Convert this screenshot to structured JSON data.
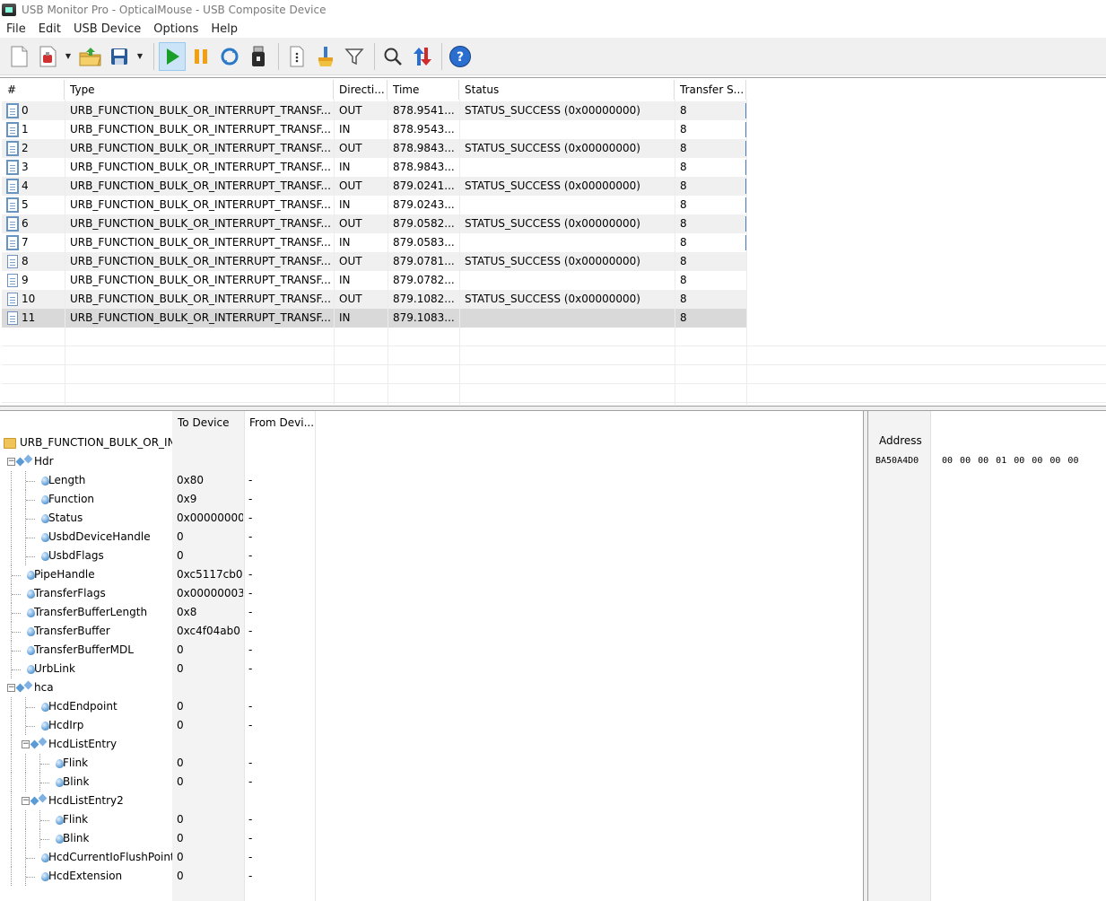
{
  "window": {
    "title": "USB Monitor Pro - OpticalMouse - USB Composite Device"
  },
  "menu": [
    "File",
    "Edit",
    "USB Device",
    "Options",
    "Help"
  ],
  "toolbar": {
    "buttons": [
      "new-icon",
      "open-session-icon",
      "open-folder-icon",
      "save-icon",
      "start-capture-icon",
      "pause-icon",
      "refresh-icon",
      "usb-device-icon",
      "properties-icon",
      "clear-icon",
      "filter-icon",
      "search-icon",
      "sort-icon",
      "help-icon"
    ],
    "colors": {
      "start": "#1a9e2a",
      "pause": "#f0a010",
      "help": "#2a6fd0",
      "active_bg": "#cce4f7"
    }
  },
  "packets": {
    "columns": [
      "#",
      "Type",
      "Directi...",
      "Time",
      "Status",
      "Transfer S..."
    ],
    "rows": [
      {
        "num": "0",
        "type": "URB_FUNCTION_BULK_OR_INTERRUPT_TRANSF...",
        "dir": "OUT",
        "time": "878.9541...",
        "status": "STATUS_SUCCESS (0x00000000)",
        "size": "8"
      },
      {
        "num": "1",
        "type": "URB_FUNCTION_BULK_OR_INTERRUPT_TRANSF...",
        "dir": "IN",
        "time": "878.9543...",
        "status": "",
        "size": "8"
      },
      {
        "num": "2",
        "type": "URB_FUNCTION_BULK_OR_INTERRUPT_TRANSF...",
        "dir": "OUT",
        "time": "878.9843...",
        "status": "STATUS_SUCCESS (0x00000000)",
        "size": "8"
      },
      {
        "num": "3",
        "type": "URB_FUNCTION_BULK_OR_INTERRUPT_TRANSF...",
        "dir": "IN",
        "time": "878.9843...",
        "status": "",
        "size": "8"
      },
      {
        "num": "4",
        "type": "URB_FUNCTION_BULK_OR_INTERRUPT_TRANSF...",
        "dir": "OUT",
        "time": "879.0241...",
        "status": "STATUS_SUCCESS (0x00000000)",
        "size": "8"
      },
      {
        "num": "5",
        "type": "URB_FUNCTION_BULK_OR_INTERRUPT_TRANSF...",
        "dir": "IN",
        "time": "879.0243...",
        "status": "",
        "size": "8"
      },
      {
        "num": "6",
        "type": "URB_FUNCTION_BULK_OR_INTERRUPT_TRANSF...",
        "dir": "OUT",
        "time": "879.0582...",
        "status": "STATUS_SUCCESS (0x00000000)",
        "size": "8"
      },
      {
        "num": "7",
        "type": "URB_FUNCTION_BULK_OR_INTERRUPT_TRANSF...",
        "dir": "IN",
        "time": "879.0583...",
        "status": "",
        "size": "8"
      },
      {
        "num": "8",
        "type": "URB_FUNCTION_BULK_OR_INTERRUPT_TRANSF...",
        "dir": "OUT",
        "time": "879.0781...",
        "status": "STATUS_SUCCESS (0x00000000)",
        "size": "8"
      },
      {
        "num": "9",
        "type": "URB_FUNCTION_BULK_OR_INTERRUPT_TRANSF...",
        "dir": "IN",
        "time": "879.0782...",
        "status": "",
        "size": "8"
      },
      {
        "num": "10",
        "type": "URB_FUNCTION_BULK_OR_INTERRUPT_TRANSF...",
        "dir": "OUT",
        "time": "879.1082...",
        "status": "STATUS_SUCCESS (0x00000000)",
        "size": "8"
      },
      {
        "num": "11",
        "type": "URB_FUNCTION_BULK_OR_INTERRUPT_TRANSF...",
        "dir": "IN",
        "time": "879.1083...",
        "status": "",
        "size": "8"
      }
    ]
  },
  "tree": {
    "columns": [
      "To Device",
      "From Devi..."
    ],
    "root": "URB_FUNCTION_BULK_OR_INTERRUPT_TRANSFER",
    "nodes": [
      {
        "label": "Hdr",
        "level": 0,
        "kind": "group",
        "to": "",
        "from": ""
      },
      {
        "label": "Length",
        "level": 1,
        "kind": "leaf",
        "to": "0x80",
        "from": "-"
      },
      {
        "label": "Function",
        "level": 1,
        "kind": "leaf",
        "to": "0x9",
        "from": "-"
      },
      {
        "label": "Status",
        "level": 1,
        "kind": "leaf",
        "to": "0x00000000 (",
        "from": "-"
      },
      {
        "label": "UsbdDeviceHandle",
        "level": 1,
        "kind": "leaf",
        "to": "0",
        "from": "-"
      },
      {
        "label": "UsbdFlags",
        "level": 1,
        "kind": "leaf",
        "to": "0",
        "from": "-"
      },
      {
        "label": "PipeHandle",
        "level": 0,
        "kind": "leaf",
        "to": "0xc5117cb0",
        "from": "-"
      },
      {
        "label": "TransferFlags",
        "level": 0,
        "kind": "leaf",
        "to": "0x00000003 (",
        "from": "-"
      },
      {
        "label": "TransferBufferLength",
        "level": 0,
        "kind": "leaf",
        "to": "0x8",
        "from": "-"
      },
      {
        "label": "TransferBuffer",
        "level": 0,
        "kind": "leaf",
        "to": "0xc4f04ab0",
        "from": "-"
      },
      {
        "label": "TransferBufferMDL",
        "level": 0,
        "kind": "leaf",
        "to": "0",
        "from": "-"
      },
      {
        "label": "UrbLink",
        "level": 0,
        "kind": "leaf",
        "to": "0",
        "from": "-"
      },
      {
        "label": "hca",
        "level": 0,
        "kind": "group",
        "to": "",
        "from": ""
      },
      {
        "label": "HcdEndpoint",
        "level": 1,
        "kind": "leaf",
        "to": "0",
        "from": "-"
      },
      {
        "label": "HcdIrp",
        "level": 1,
        "kind": "leaf",
        "to": "0",
        "from": "-"
      },
      {
        "label": "HcdListEntry",
        "level": 1,
        "kind": "group",
        "to": "",
        "from": ""
      },
      {
        "label": "Flink",
        "level": 2,
        "kind": "leaf",
        "to": "0",
        "from": "-"
      },
      {
        "label": "Blink",
        "level": 2,
        "kind": "leaf",
        "to": "0",
        "from": "-"
      },
      {
        "label": "HcdListEntry2",
        "level": 1,
        "kind": "group",
        "to": "",
        "from": ""
      },
      {
        "label": "Flink",
        "level": 2,
        "kind": "leaf",
        "to": "0",
        "from": "-"
      },
      {
        "label": "Blink",
        "level": 2,
        "kind": "leaf",
        "to": "0",
        "from": "-"
      },
      {
        "label": "HcdCurrentIoFlushPointer",
        "level": 1,
        "kind": "leaf",
        "to": "0",
        "from": "-"
      },
      {
        "label": "HcdExtension",
        "level": 1,
        "kind": "leaf",
        "to": "0",
        "from": "-"
      }
    ]
  },
  "hex": {
    "header": "Address",
    "address": "BA50A4D0",
    "bytes": "00 00 00 01 00 00 00 00"
  }
}
